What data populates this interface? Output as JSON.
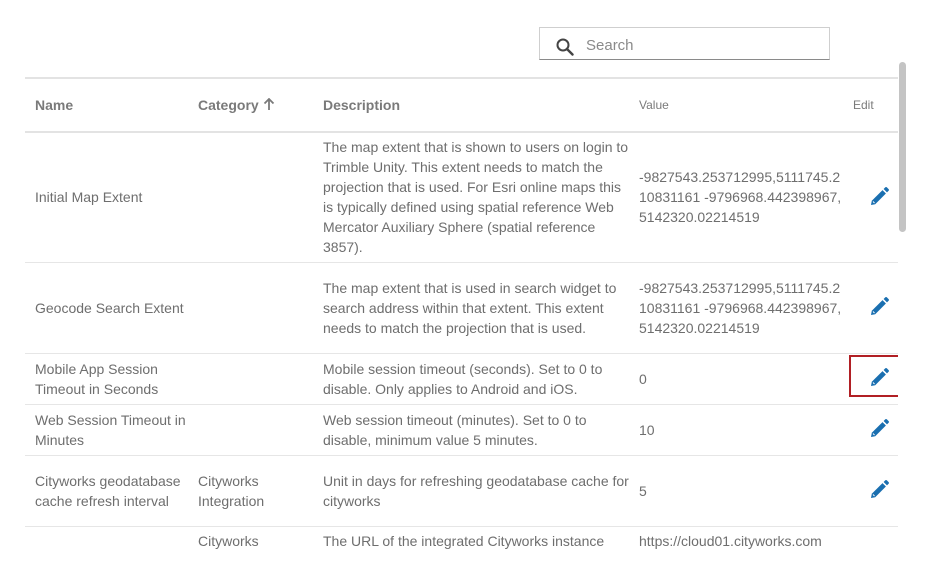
{
  "search": {
    "placeholder": "Search",
    "value": ""
  },
  "table": {
    "headers": {
      "name": "Name",
      "category": "Category",
      "description": "Description",
      "value": "Value",
      "edit": "Edit"
    },
    "sort": {
      "column": "Category",
      "direction": "ascending"
    },
    "rows": [
      {
        "name": "Initial Map Extent",
        "category": "",
        "description": "The map extent that is shown to users on login to Trimble Unity. This extent needs to match the projection that is used. For Esri online maps this is typically defined using spatial reference Web Mercator Auxiliary Sphere (spatial reference 3857).",
        "value": "-9827543.253712995,5111745.210831161 -9796968.442398967,5142320.02214519"
      },
      {
        "name": "Geocode Search Extent",
        "category": "",
        "description": "The map extent that is used in search widget to search address within that extent. This extent needs to match the projection that is used.",
        "value": "-9827543.253712995,5111745.210831161 -9796968.442398967,5142320.02214519"
      },
      {
        "name": "Mobile App Session Timeout in Seconds",
        "category": "",
        "description": "Mobile session timeout (seconds). Set to 0 to disable. Only applies to Android and iOS.",
        "value": "0"
      },
      {
        "name": "Web Session Timeout in Minutes",
        "category": "",
        "description": "Web session timeout (minutes). Set to 0 to disable, minimum value 5 minutes.",
        "value": "10"
      },
      {
        "name": "Cityworks geodatabase cache refresh interval",
        "category": "Cityworks Integration",
        "description": "Unit in days for refreshing geodatabase cache for cityworks",
        "value": "5"
      },
      {
        "name": "",
        "category": "Cityworks",
        "description": "The URL of the integrated Cityworks instance",
        "value": "https://cloud01.cityworks.com"
      }
    ]
  },
  "colors": {
    "accent_blue": "#1a6fb0",
    "focus_red": "#b11f24"
  },
  "icons": {
    "search": "search-icon",
    "edit": "pencil-icon",
    "sort": "arrow-up-icon"
  }
}
